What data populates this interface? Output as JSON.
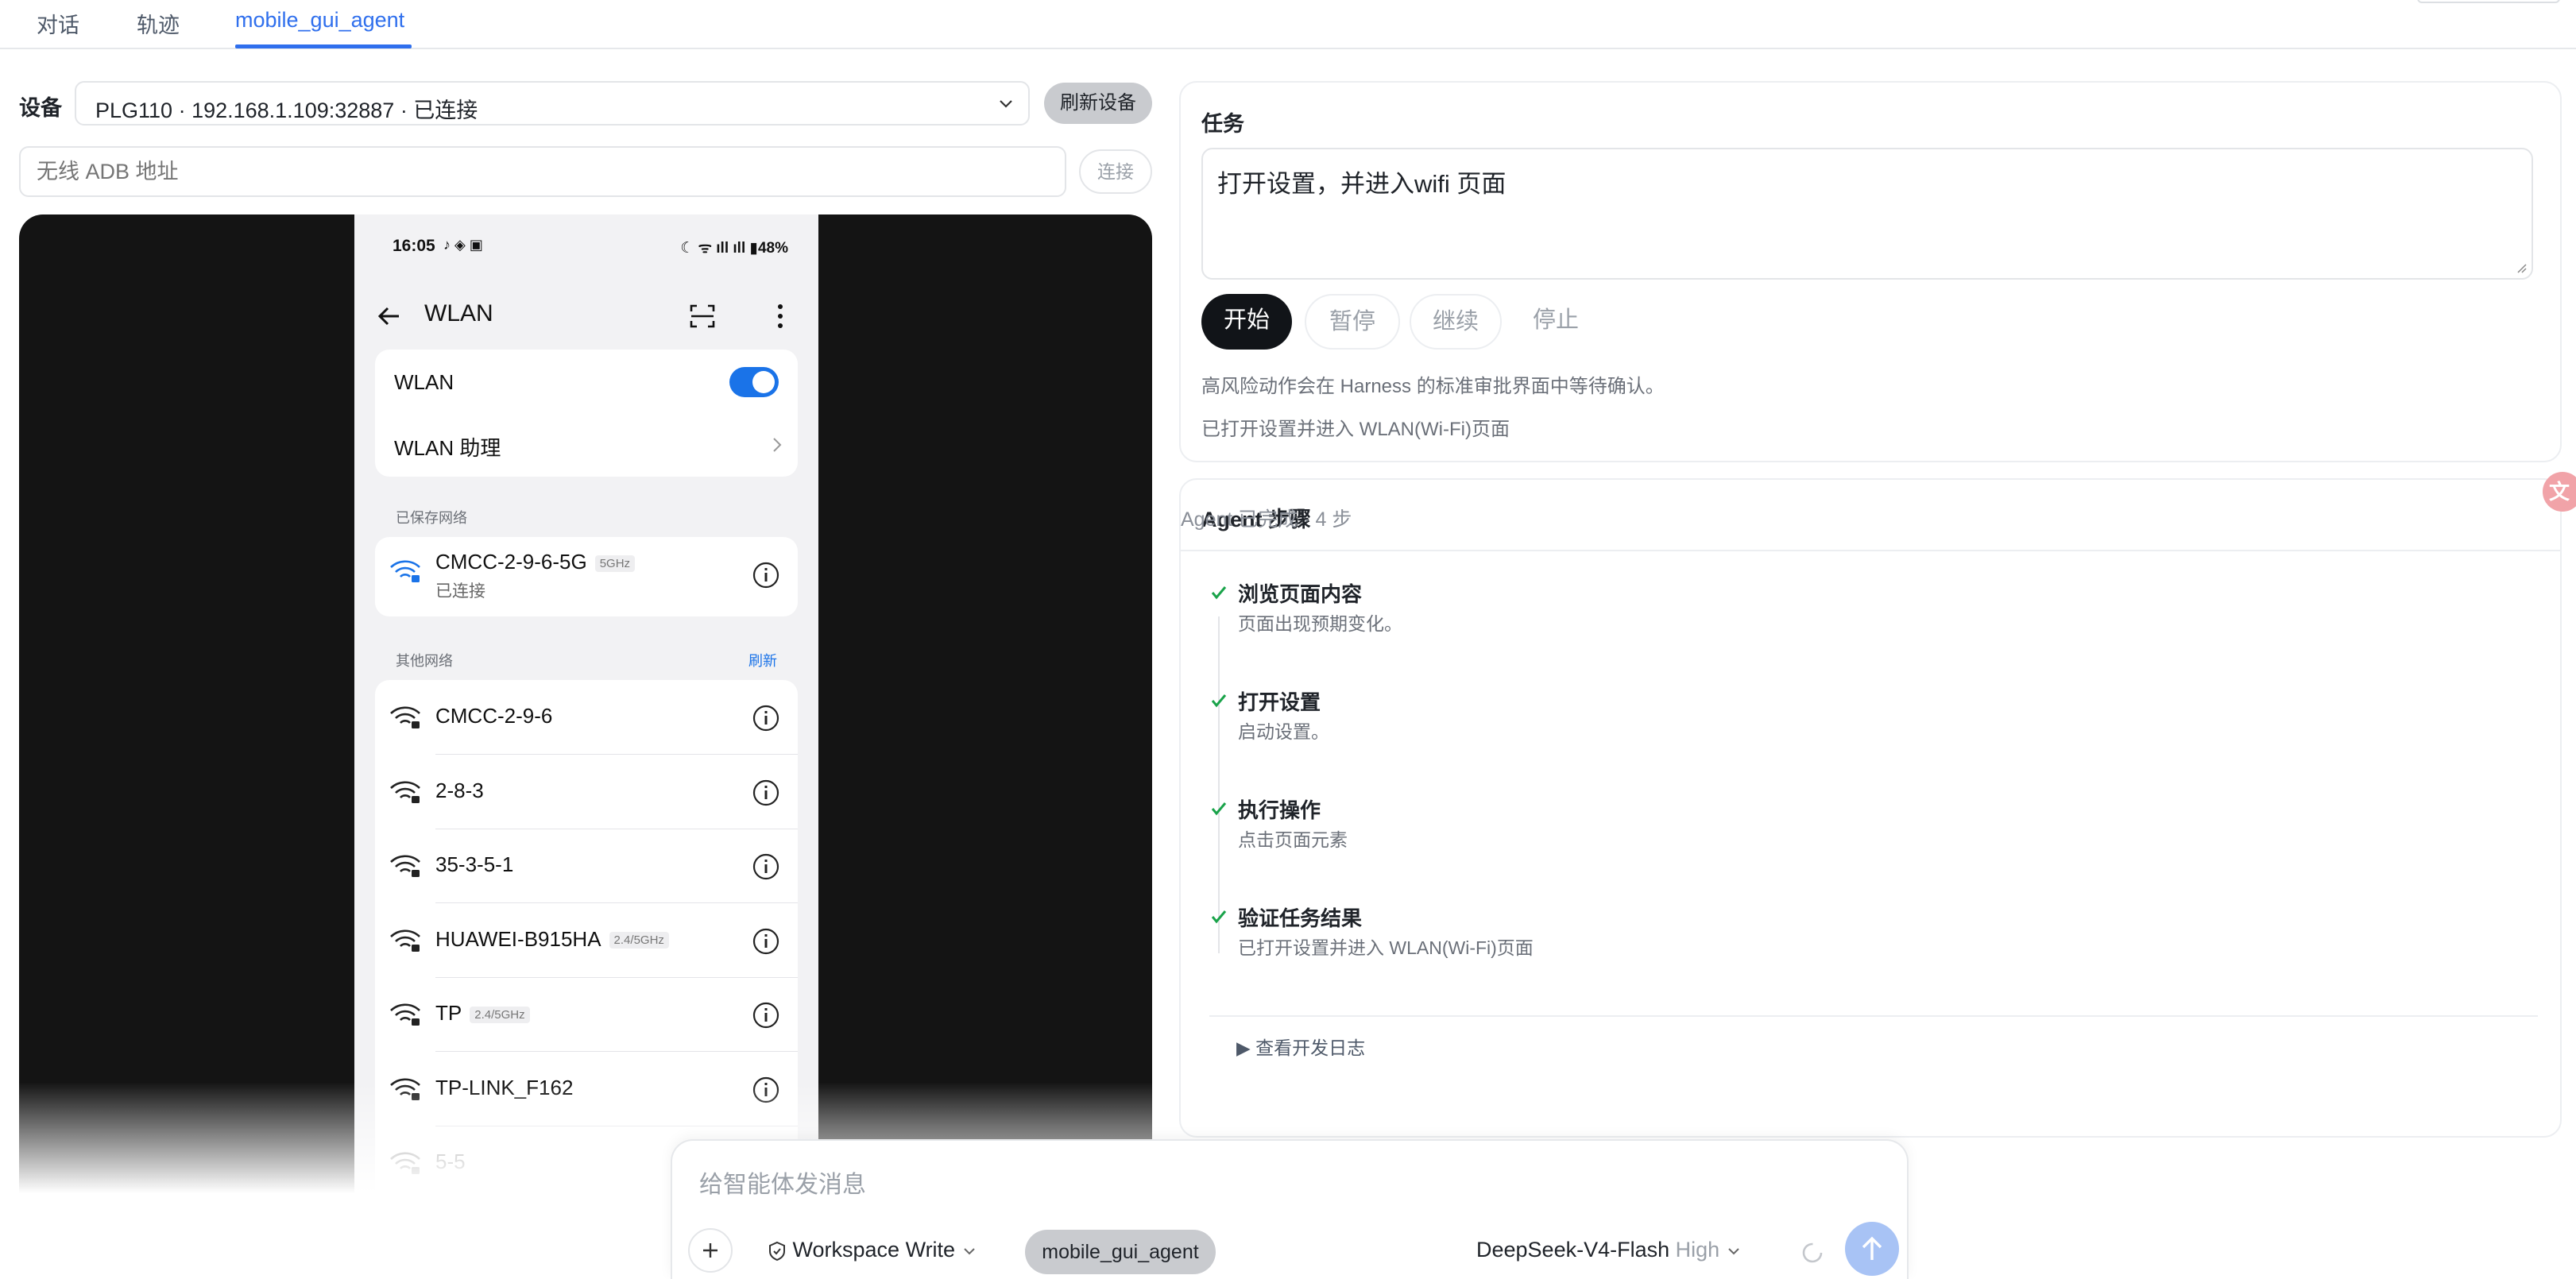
{
  "tabs": [
    {
      "label": "对话",
      "active": false
    },
    {
      "label": "轨迹",
      "active": false
    },
    {
      "label": "mobile_gui_agent",
      "active": true
    }
  ],
  "device": {
    "label": "设备",
    "selected": "PLG110 · 192.168.1.109:32887 · 已连接",
    "refresh_label": "刷新设备",
    "adb_placeholder": "无线 ADB 地址",
    "connect_label": "连接"
  },
  "phone": {
    "time": "16:05",
    "status_left_icons": "♪ ◈ ▣",
    "status_right": "☾ ᯤ ıll ıll ▮48%",
    "title": "WLAN",
    "wlan_toggle_label": "WLAN",
    "wlan_enabled": true,
    "assistant_label": "WLAN 助理",
    "saved_caption": "已保存网络",
    "saved_network": {
      "name": "CMCC-2-9-6-5G",
      "band": "5GHz",
      "status": "已连接"
    },
    "other_caption": "其他网络",
    "refresh_label": "刷新",
    "networks": [
      {
        "name": "CMCC-2-9-6",
        "band": ""
      },
      {
        "name": "2-8-3",
        "band": ""
      },
      {
        "name": "35-3-5-1",
        "band": ""
      },
      {
        "name": "HUAWEI-B915HA",
        "band": "2.4/5GHz"
      },
      {
        "name": "TP",
        "band": "2.4/5GHz"
      },
      {
        "name": "TP-LINK_F162",
        "band": ""
      },
      {
        "name": "5-5",
        "band": ""
      }
    ]
  },
  "task": {
    "heading": "任务",
    "text": "打开设置，并进入wifi 页面",
    "buttons": {
      "start": "开始",
      "pause": "暂停",
      "resume": "继续",
      "stop": "停止"
    },
    "note": "高风险动作会在 Harness 的标准审批界面中等待确认。",
    "result": "已打开设置并进入 WLAN(Wi-Fi)页面"
  },
  "steps": {
    "heading": "Agent 步骤",
    "status": "Agent 已完成 · 4 步",
    "items": [
      {
        "title": "浏览页面内容",
        "desc": "页面出现预期变化。"
      },
      {
        "title": "打开设置",
        "desc": "启动设置。"
      },
      {
        "title": "执行操作",
        "desc": "点击页面元素"
      },
      {
        "title": "验证任务结果",
        "desc": "已打开设置并进入 WLAN(Wi-Fi)页面"
      }
    ],
    "devlog_label": "▶ 查看开发日志"
  },
  "composer": {
    "placeholder": "给智能体发消息",
    "permission": "Workspace Write",
    "agent": "mobile_gui_agent",
    "model": "DeepSeek-V4-Flash",
    "level": "High"
  },
  "colors": {
    "accent": "#2f6fed",
    "success": "#1aa34a",
    "toggle": "#1a73e8"
  }
}
